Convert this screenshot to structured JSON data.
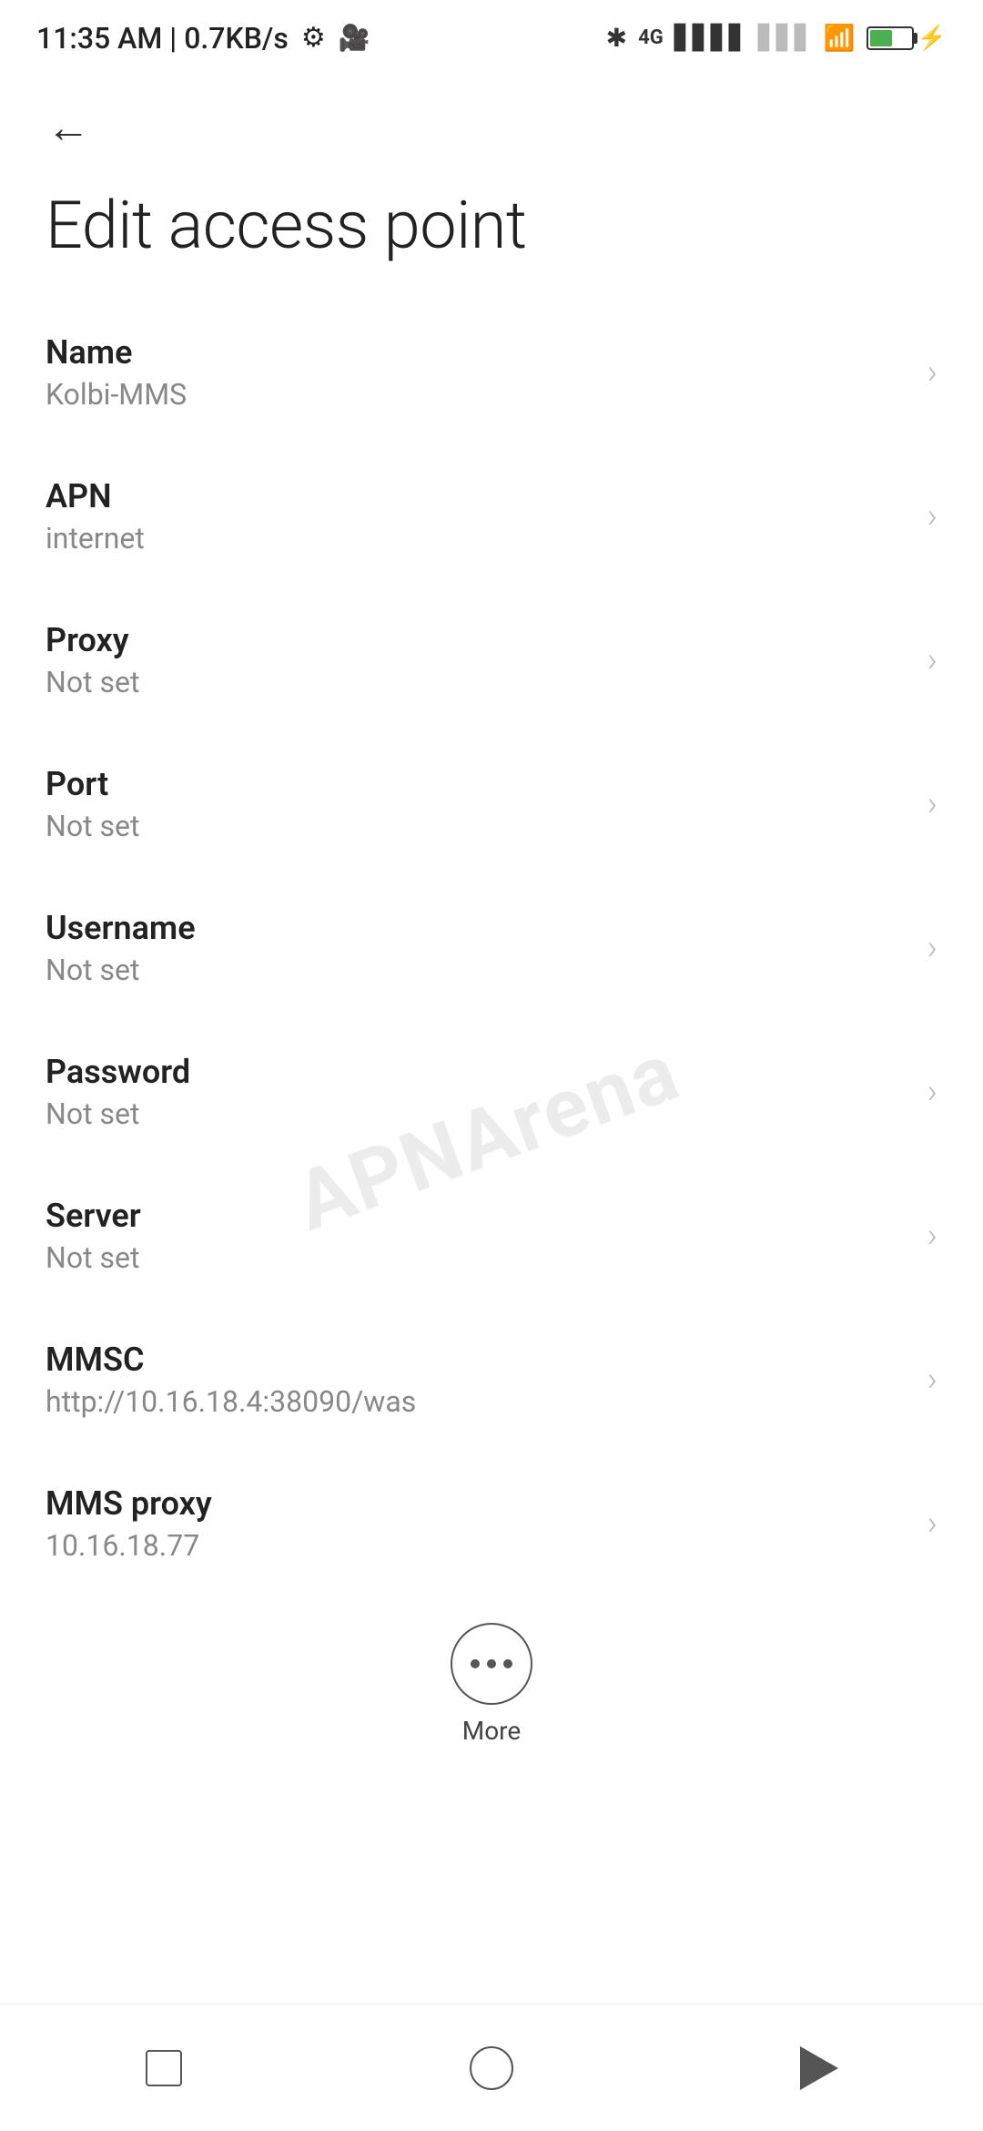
{
  "statusBar": {
    "time": "11:35 AM | 0.7KB/s",
    "settingsIcon": "gear-icon",
    "cameraIcon": "camera-icon",
    "bluetoothIcon": "bluetooth-icon",
    "signalIcon": "signal-icon",
    "wifiIcon": "wifi-icon",
    "batteryPercent": "38",
    "chargeIcon": "charge-icon"
  },
  "toolbar": {
    "backLabel": "←"
  },
  "page": {
    "title": "Edit access point"
  },
  "settings": [
    {
      "id": "name",
      "title": "Name",
      "value": "Kolbi-MMS"
    },
    {
      "id": "apn",
      "title": "APN",
      "value": "internet"
    },
    {
      "id": "proxy",
      "title": "Proxy",
      "value": "Not set"
    },
    {
      "id": "port",
      "title": "Port",
      "value": "Not set"
    },
    {
      "id": "username",
      "title": "Username",
      "value": "Not set"
    },
    {
      "id": "password",
      "title": "Password",
      "value": "Not set"
    },
    {
      "id": "server",
      "title": "Server",
      "value": "Not set"
    },
    {
      "id": "mmsc",
      "title": "MMSC",
      "value": "http://10.16.18.4:38090/was"
    },
    {
      "id": "mms-proxy",
      "title": "MMS proxy",
      "value": "10.16.18.77"
    }
  ],
  "more": {
    "label": "More"
  },
  "watermark": {
    "text": "APNArena"
  },
  "navbar": {
    "recentsLabel": "recents",
    "homeLabel": "home",
    "backLabel": "back"
  }
}
